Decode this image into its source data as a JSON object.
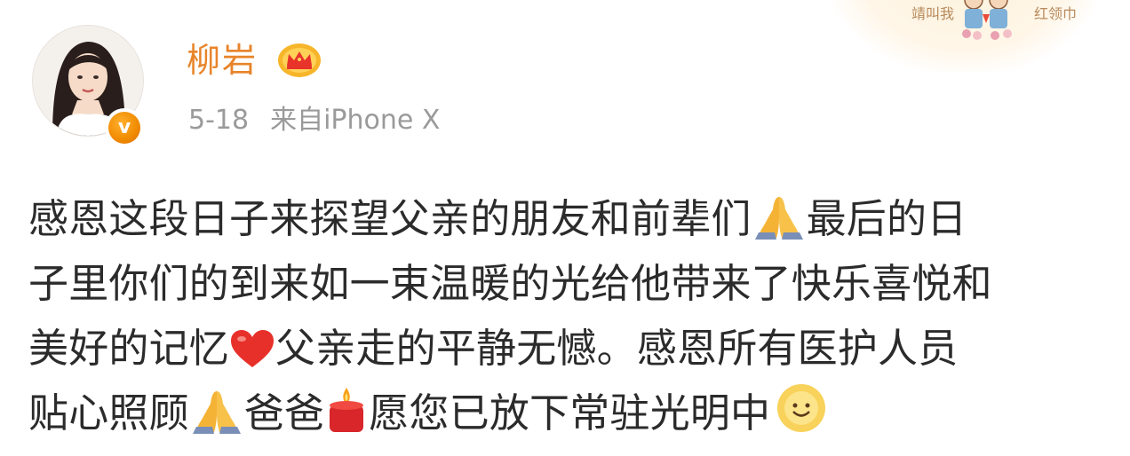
{
  "post": {
    "username": "柳岩",
    "date": "5-18",
    "source": "来自iPhone X",
    "sticker": {
      "left_text": "靖叫我",
      "right_text": "红领巾"
    },
    "content": {
      "line1_a": "感恩这段日子来探望父亲的朋友和前辈们",
      "line1_b": "最后的日",
      "line2": "子里你们的到来如一束温暖的光给他带来了快乐喜悦和",
      "line3_a": "美好的记忆",
      "line3_b": "父亲走的平静无憾。感恩所有医护人员",
      "line4_a": "贴心照顾",
      "line4_b": "爸爸",
      "line4_c": "愿您已放下常驻光明中"
    },
    "icons": {
      "verified": "verified-v-badge",
      "member": "crown-icon",
      "pray": "pray-hands-icon",
      "heart": "heart-icon",
      "candle": "candle-icon",
      "sun": "sun-smile-icon"
    },
    "colors": {
      "username": "#e8842a",
      "meta": "#9a9a9a",
      "text": "#2b2b2b",
      "badge": "#f08a00",
      "heart": "#e8302a"
    }
  }
}
